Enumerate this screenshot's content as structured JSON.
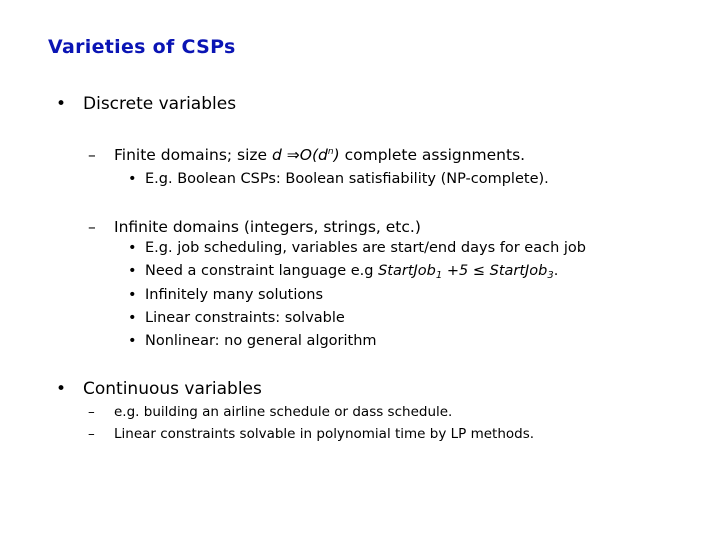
{
  "slide": {
    "title": "Varieties of CSPs",
    "title_color": "#0a14b4",
    "sections": [
      {
        "label": "Discrete variables",
        "items": [
          {
            "label_prefix": "Finite domains; size ",
            "label_var": "d",
            "label_arrow": " ⇒",
            "label_big_o": "O(d",
            "label_exp": "n",
            "label_close": ")",
            "label_suffix": " complete assignments.",
            "subitems": [
              "E.g. Boolean CSPs: Boolean satisfiability (NP-complete)."
            ]
          },
          {
            "label": "Infinite domains (integers, strings, etc.)",
            "subitems": [
              "E.g. job scheduling, variables are start/end days for each job",
              {
                "prefix": "Need a constraint language e.g ",
                "var1": "StartJob",
                "sub1": "1",
                "mid": " +5 ≤ ",
                "var2": "StartJob",
                "sub2": "3",
                "suffix": "."
              },
              "Infinitely many solutions",
              "Linear constraints: solvable",
              "Nonlinear: no general algorithm"
            ]
          }
        ]
      },
      {
        "label": "Continuous variables",
        "items": [
          "e.g. building an airline schedule or dass schedule.",
          "Linear constraints solvable in polynomial time by LP methods."
        ]
      }
    ],
    "bullet": "•",
    "dash": "–"
  }
}
